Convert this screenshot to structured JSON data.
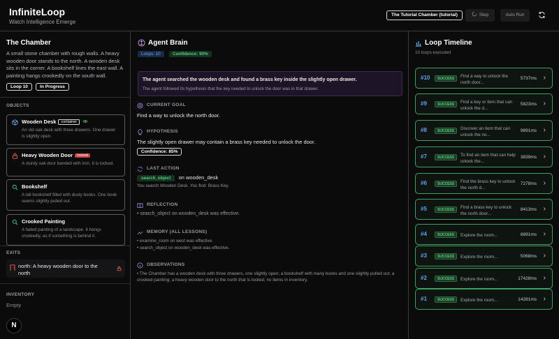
{
  "app": {
    "title": "InfiniteLoop",
    "subtitle": "Watch Intelligence Emerge"
  },
  "header": {
    "scenario": "The Tutorial Chamber (tutorial)",
    "step_label": "Step",
    "auto_run_label": "Auto Run"
  },
  "room": {
    "title": "The Chamber",
    "description": "A small stone chamber with rough walls. A heavy wooden door stands to the north. A wooden desk sits in the corner. A bookshelf lines the east wall. A painting hangs crookedly on the south wall.",
    "loop_badge": "Loop 10",
    "status_badge": "In Progress"
  },
  "objects": {
    "heading": "OBJECTS",
    "items": [
      {
        "name": "Wooden Desk",
        "tag": "container",
        "desc": "An old oak desk with three drawers. One drawer is slightly open.",
        "icon": "cube-icon"
      },
      {
        "name": "Bookshelf",
        "tag": "",
        "desc": "A tall bookshelf filled with dusty books. One book seems slightly pulled out.",
        "icon": "search-icon"
      },
      {
        "name": "Crooked Painting",
        "tag": "",
        "desc": "A faded painting of a landscape. It hangs crookedly, as if something is behind it.",
        "icon": "search-icon"
      },
      {
        "name": "Heavy Wooden Door",
        "tag": "locked",
        "desc": "A sturdy oak door banded with iron. It is locked.",
        "icon": "lock-icon"
      }
    ]
  },
  "exits": {
    "heading": "EXITS",
    "items": [
      {
        "label": "north: A heavy wooden door to the north"
      }
    ]
  },
  "inventory": {
    "heading": "INVENTORY",
    "value": "Empty"
  },
  "brain": {
    "title": "Agent Brain",
    "loops_badge": "Loops: 10",
    "confidence_badge": "Confidence: 90%",
    "banner_title": "The agent searched the wooden desk and found a brass key inside the slightly open drawer.",
    "banner_sub": "The agent followed its hypothesis that the key needed to unlock the door was in that drawer.",
    "goal_heading": "CURRENT GOAL",
    "goal": "Find a way to unlock the north door.",
    "hypothesis_heading": "HYPOTHESIS",
    "hypothesis": "The slightly open drawer may contain a brass key needed to unlock the door.",
    "hypothesis_conf": "Confidence: 85%",
    "action_heading": "LAST ACTION",
    "action_name": "search_object",
    "action_target": "on wooden_desk",
    "action_result": "You search Wooden Desk. You find: Brass Key.",
    "reflection_heading": "REFLECTION",
    "reflection": "• search_object on wooden_desk was effective.",
    "memory_heading": "MEMORY (ALL LESSONS)",
    "memory": [
      "• examine_room on west was effective.",
      "• search_object on wooden_desk was effective."
    ],
    "observations_heading": "OBSERVATIONS",
    "observations": "• The Chamber has a wooden desk with three drawers, one slightly open; a bookshelf with many books and one slightly pulled out; a crooked painting; a heavy wooden door to the north that is locked; no items in inventory."
  },
  "timeline": {
    "title": "Loop Timeline",
    "count": "10 loops executed",
    "items": [
      {
        "num": "#10",
        "status": "SUCCESS",
        "goal": "Find a way to unlock the north door...",
        "ms": "5737ms"
      },
      {
        "num": "#9",
        "status": "SUCCESS",
        "goal": "Find a key or item that can unlock the d...",
        "ms": "5823ms"
      },
      {
        "num": "#8",
        "status": "SUCCESS",
        "goal": "Discover an item that can unlock the no...",
        "ms": "9891ms"
      },
      {
        "num": "#7",
        "status": "SUCCESS",
        "goal": "To find an item that can help unlock the...",
        "ms": "3839ms"
      },
      {
        "num": "#6",
        "status": "SUCCESS",
        "goal": "Find the brass key to unlock the north d...",
        "ms": "7278ms"
      },
      {
        "num": "#5",
        "status": "SUCCESS",
        "goal": "Find a brass key to unlock the north door...",
        "ms": "8413ms"
      },
      {
        "num": "#4",
        "status": "SUCCESS",
        "goal": "Explore the room...",
        "ms": "8891ms"
      },
      {
        "num": "#3",
        "status": "SUCCESS",
        "goal": "Explore the room...",
        "ms": "5068ms"
      },
      {
        "num": "#2",
        "status": "SUCCESS",
        "goal": "Explore the room...",
        "ms": "17428ms"
      },
      {
        "num": "#1",
        "status": "SUCCESS",
        "goal": "Explore the room...",
        "ms": "14281ms"
      }
    ]
  },
  "footer": {
    "logo": "N"
  }
}
